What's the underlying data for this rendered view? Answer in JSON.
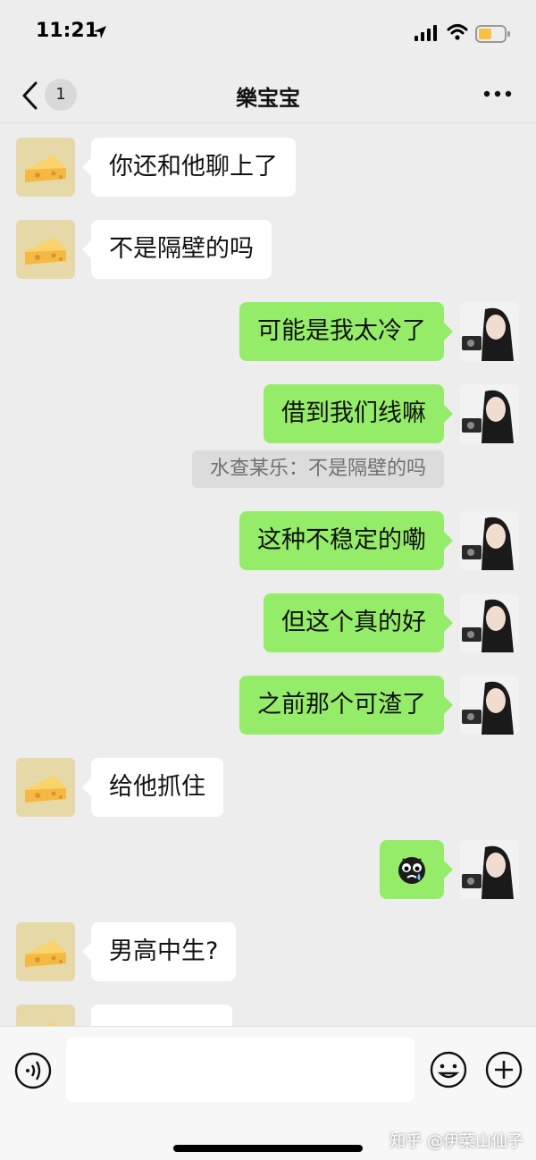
{
  "status_bar": {
    "time": "11:21",
    "icons": [
      "location-arrow-icon",
      "cellular-signal-icon",
      "wifi-icon",
      "battery-icon"
    ]
  },
  "nav": {
    "back_icon": "chevron-left-icon",
    "unread_count": "1",
    "title": "樂宝宝",
    "more_icon": "more-dots-icon"
  },
  "messages": [
    {
      "side": "left",
      "text": "你还和他聊上了",
      "avatar": "cheese-avatar"
    },
    {
      "side": "left",
      "text": "不是隔壁的吗",
      "avatar": "cheese-avatar"
    },
    {
      "side": "right",
      "text": "可能是我太冷了",
      "avatar": "girl-with-camera-avatar"
    },
    {
      "side": "right",
      "text": "借到我们线嘛",
      "avatar": "girl-with-camera-avatar",
      "quote": "水查某乐：不是隔壁的吗"
    },
    {
      "side": "right",
      "text": "这种不稳定的嘞",
      "avatar": "girl-with-camera-avatar"
    },
    {
      "side": "right",
      "text": "但这个真的好",
      "avatar": "girl-with-camera-avatar"
    },
    {
      "side": "right",
      "text": "之前那个可渣了",
      "avatar": "girl-with-camera-avatar"
    },
    {
      "side": "left",
      "text": "给他抓住",
      "avatar": "cheese-avatar"
    },
    {
      "side": "right",
      "text": "",
      "emoji": "crying-face-emoji-icon",
      "avatar": "girl-with-camera-avatar"
    },
    {
      "side": "left",
      "text": "男高中生?",
      "avatar": "cheese-avatar"
    }
  ],
  "input_bar": {
    "voice_icon": "voice-input-icon",
    "text_value": "",
    "emoji_icon": "emoji-smile-icon",
    "plus_icon": "plus-circle-icon"
  },
  "watermark": "知乎 @伊菜山仙子",
  "colors": {
    "background": "#ededed",
    "sent_bubble": "#95ec69",
    "received_bubble": "#ffffff",
    "quote_bg": "#dcdcdc"
  }
}
